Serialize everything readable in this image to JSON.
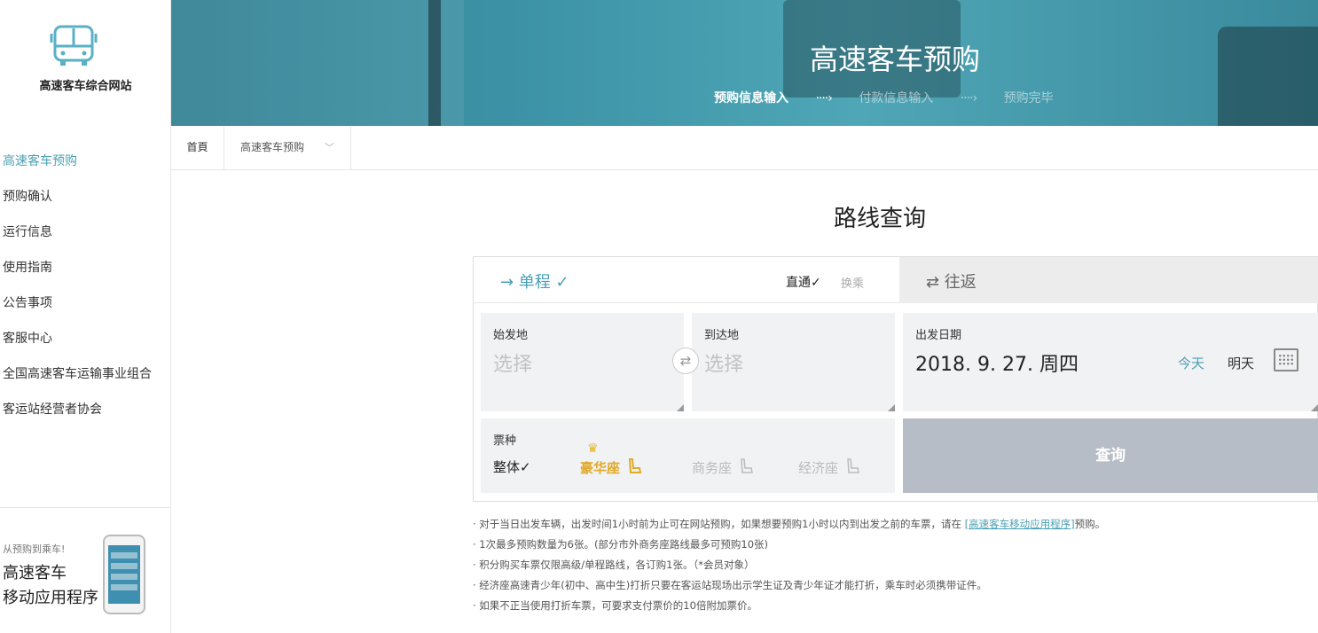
{
  "site": {
    "logo_text": "高速客车综合网站"
  },
  "sidebar": {
    "items": [
      {
        "label": "高速客车预购",
        "active": true
      },
      {
        "label": "预购确认"
      },
      {
        "label": "运行信息"
      },
      {
        "label": "使用指南"
      },
      {
        "label": "公告事项"
      },
      {
        "label": "客服中心"
      },
      {
        "label": "全国高速客车运输事业组合"
      },
      {
        "label": "客运站经营者协会"
      }
    ],
    "promo": {
      "small": "从预购到乘车!",
      "line1": "高速客车",
      "line2": "移动应用程序"
    }
  },
  "header": {
    "title": "高速客车预购",
    "steps": [
      "预购信息输入",
      "付款信息输入",
      "预购完毕"
    ],
    "step_arrow": "····›"
  },
  "breadcrumb": {
    "home": "首頁",
    "page": "高速客车预购"
  },
  "main": {
    "title": "路线查询",
    "tabs": {
      "one_way": "→ 单程 ✓",
      "direct": "直通✓",
      "transfer": "换乘",
      "round_trip": "⇄ 往返"
    },
    "from": {
      "label": "始发地",
      "placeholder": "选择"
    },
    "to": {
      "label": "到达地",
      "placeholder": "选择"
    },
    "date": {
      "label": "出发日期",
      "value": "2018. 9. 27. 周四",
      "today": "今天",
      "tomorrow": "明天"
    },
    "ticket_type": {
      "label": "票种",
      "all": "整体✓",
      "luxury": "豪华座",
      "business": "商务座",
      "economy": "经济座"
    },
    "search_button": "查询",
    "notes": [
      {
        "text": "· 对于当日出发车辆，出发时间1小时前为止可在网站预购，如果想要预购1小时以内到出发之前的车票，请在 ",
        "link": "[高速客车移动应用程序]",
        "after": "预购。"
      },
      {
        "text": "· 1次最多预购数量为6张。(部分市外商务座路线最多可预购10张)"
      },
      {
        "text": "· 积分购买车票仅限高级/单程路线，各订购1张。（*会员对象）"
      },
      {
        "text": "· 经济座高速青少年(初中、高中生)打折只要在客运站现场出示学生证及青少年证才能打折，乘车时必须携带证件。"
      },
      {
        "text": "· 如果不正当使用打折车票，可要求支付票价的10倍附加票价。"
      }
    ]
  },
  "colors": {
    "accent": "#4aa0b5",
    "gold": "#e0a92a",
    "button": "#b7bdc7",
    "banner": "#3f96a8"
  }
}
